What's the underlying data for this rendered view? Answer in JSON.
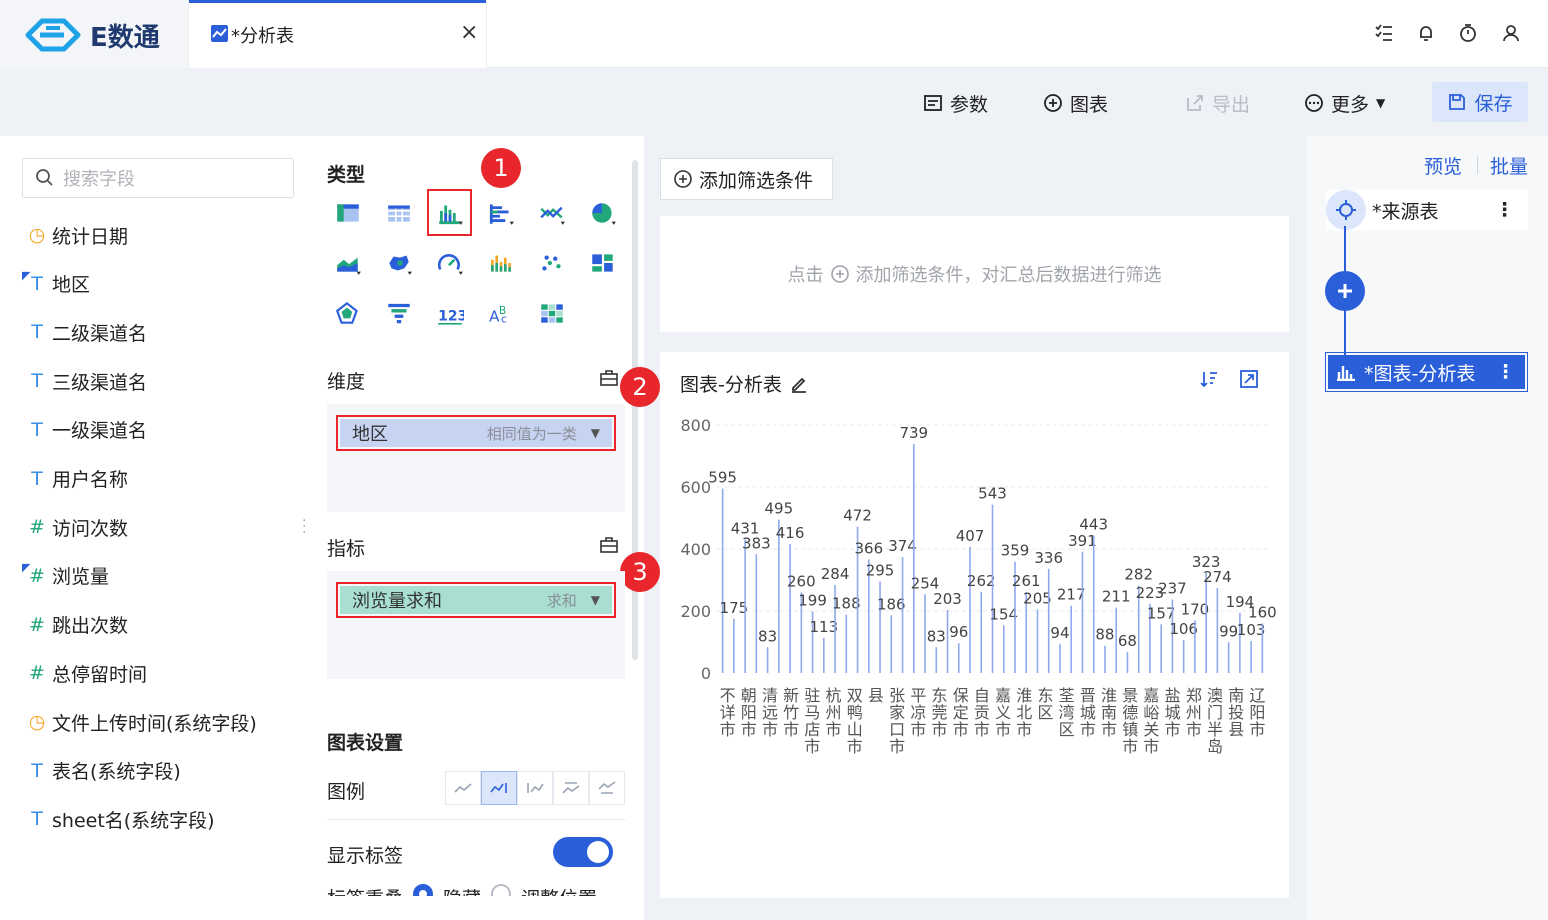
{
  "app": {
    "logo_text": "E数通",
    "tab_title": "*分析表",
    "tab_close": "×"
  },
  "toolbar": {
    "params": "参数",
    "chart": "图表",
    "export": "导出",
    "more": "更多",
    "save": "保存"
  },
  "fields": {
    "search_placeholder": "搜索字段",
    "items": [
      {
        "label": "统计日期",
        "icon": "clock-icon"
      },
      {
        "label": "地区",
        "icon": "text-geo-icon"
      },
      {
        "label": "二级渠道名",
        "icon": "text-icon"
      },
      {
        "label": "三级渠道名",
        "icon": "text-icon"
      },
      {
        "label": "一级渠道名",
        "icon": "text-icon"
      },
      {
        "label": "用户名称",
        "icon": "text-icon"
      },
      {
        "label": "访问次数",
        "icon": "number-icon"
      },
      {
        "label": "浏览量",
        "icon": "number-geo-icon"
      },
      {
        "label": "跳出次数",
        "icon": "number-icon"
      },
      {
        "label": "总停留时间",
        "icon": "number-icon"
      },
      {
        "label": "文件上传时间(系统字段)",
        "icon": "clock-icon"
      },
      {
        "label": "表名(系统字段)",
        "icon": "text-icon"
      },
      {
        "label": "sheet名(系统字段)",
        "icon": "text-icon"
      }
    ]
  },
  "config": {
    "type_title": "类型",
    "dimension_title": "维度",
    "dimension_field": "地区",
    "dimension_hint": "相同值为一类",
    "metric_title": "指标",
    "metric_field": "浏览量求和",
    "metric_hint": "求和",
    "settings_title": "图表设置",
    "legend_label": "图例",
    "show_label": "显示标签",
    "overlap_label": "标签重叠",
    "overlap_opt1": "隐藏",
    "overlap_opt2": "调整位置",
    "annotations": [
      "1",
      "2",
      "3"
    ]
  },
  "filter": {
    "add_button": "添加筛选条件",
    "hint_prefix": "点击",
    "hint_suffix": "添加筛选条件，对汇总后数据进行筛选"
  },
  "chart": {
    "title": "图表-分析表"
  },
  "flow": {
    "preview": "预览",
    "batch": "批量",
    "source_node": "*来源表",
    "chart_node": "*图表-分析表"
  },
  "colors": {
    "accent": "#2b5fd9",
    "annotation": "#e8262b",
    "bar": "#8fa9ee"
  },
  "chart_data": {
    "type": "bar",
    "yticks": [
      0,
      200,
      400,
      800,
      600
    ],
    "ylim": [
      0,
      800
    ],
    "categories": [
      "不详市",
      "朝阳市",
      "清远市",
      "新竹市",
      "驻马店市",
      "杭州市",
      "双鸭山市",
      "县",
      "张家口市",
      "平凉市",
      "东莞市",
      "保定市",
      "自贡市",
      "嘉义市",
      "淮北市",
      "东区",
      "荃湾区",
      "晋城市",
      "淮南市",
      "景德镇市",
      "嘉峪关市",
      "盐城市",
      "郑州市",
      "澳门半岛",
      "南投县",
      "辽阳市"
    ],
    "values": [
      595,
      175,
      431,
      383,
      83,
      495,
      416,
      260,
      199,
      113,
      284,
      188,
      472,
      366,
      295,
      186,
      374,
      739,
      254,
      83,
      203,
      96,
      407,
      262,
      543,
      154,
      359,
      261,
      205,
      336,
      94,
      217,
      391,
      443,
      88,
      211,
      68,
      282,
      223,
      157,
      237,
      106,
      170,
      323,
      274,
      99,
      194,
      103,
      160
    ]
  }
}
